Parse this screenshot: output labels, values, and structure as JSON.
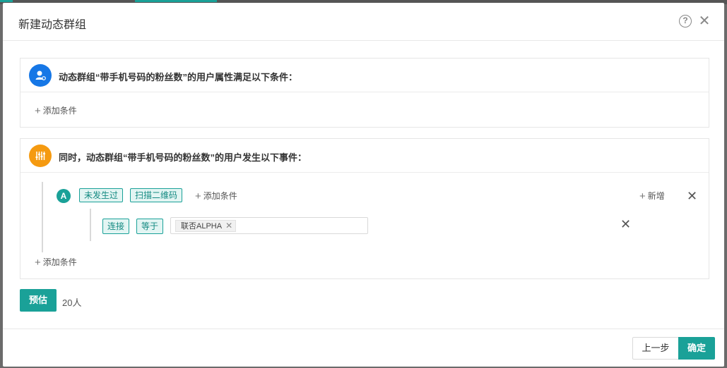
{
  "dialog": {
    "title": "新建动态群组"
  },
  "panel1": {
    "title": "动态群组“带手机号码的粉丝数”的用户属性满足以下条件：",
    "add_condition": "添加条件"
  },
  "panel2": {
    "title": "同时，动态群组“带手机号码的粉丝数”的用户发生以下事件：",
    "event": {
      "letter": "A",
      "status_tag": "未发生过",
      "action_tag": "扫描二维码",
      "add_condition": "添加条件",
      "new_label": "新增",
      "condition": {
        "field_tag": "连接",
        "operator_tag": "等于",
        "selected_values": [
          "联否ALPHA"
        ]
      }
    },
    "add_condition": "添加条件"
  },
  "estimate": {
    "button": "预估",
    "result": "20人"
  },
  "footer": {
    "prev": "上一步",
    "confirm": "确定"
  },
  "icons": {
    "help": "help-circle-icon",
    "close": "close-icon",
    "user_attr": "user-icon",
    "event": "sliders-icon"
  },
  "colors": {
    "accent": "#1aa198",
    "blue_badge": "#1677e6",
    "orange_badge": "#f59a10"
  }
}
